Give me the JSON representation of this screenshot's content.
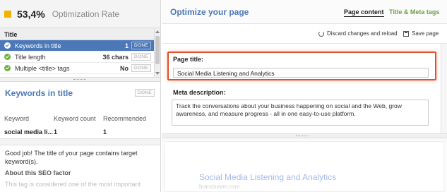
{
  "optimization": {
    "value": "53,4%",
    "label": "Optimization Rate",
    "accent": "#f0b400"
  },
  "factors": {
    "header": "Title",
    "rows": [
      {
        "name": "Keywords in title",
        "value": "1",
        "status": "DONE",
        "selected": true
      },
      {
        "name": "Title length",
        "value": "36 chars",
        "status": "DONE",
        "selected": false
      },
      {
        "name": "Multiple <title> tags",
        "value": "No",
        "status": "DONE",
        "selected": false
      }
    ]
  },
  "keywords_panel": {
    "title": "Keywords in title",
    "status": "DONE",
    "columns": [
      "Keyword",
      "Keyword count",
      "Recommended"
    ],
    "rows": [
      {
        "keyword": "social media li...",
        "count": "1",
        "recommended": "1"
      }
    ],
    "message": "Good job! The title of your page contains target keyword(s).",
    "about_heading": "About this SEO factor",
    "about_text": "This tag is considered one of the most important"
  },
  "editor": {
    "title": "Optimize your page",
    "tabs": [
      "Page content",
      "Title & Meta tags"
    ],
    "discard_label": "Discard changes and reload",
    "save_label": "Save page",
    "page_title_label": "Page title:",
    "page_title_value": "Social Media Listening and Analytics",
    "meta_description_label": "Meta description:",
    "meta_description_value": "Track the conversations about your business happening on social and the Web, grow awareness, and measure progress - all in one easy-to-use platform."
  },
  "preview": {
    "title": "Social Media Listening and Analytics",
    "url": "brandsmon.com"
  },
  "colors": {
    "selected_row": "#4c78b8",
    "highlight_border": "#e0502a",
    "link_blue": "#4c78b8",
    "tab_green": "#6aa04a"
  }
}
